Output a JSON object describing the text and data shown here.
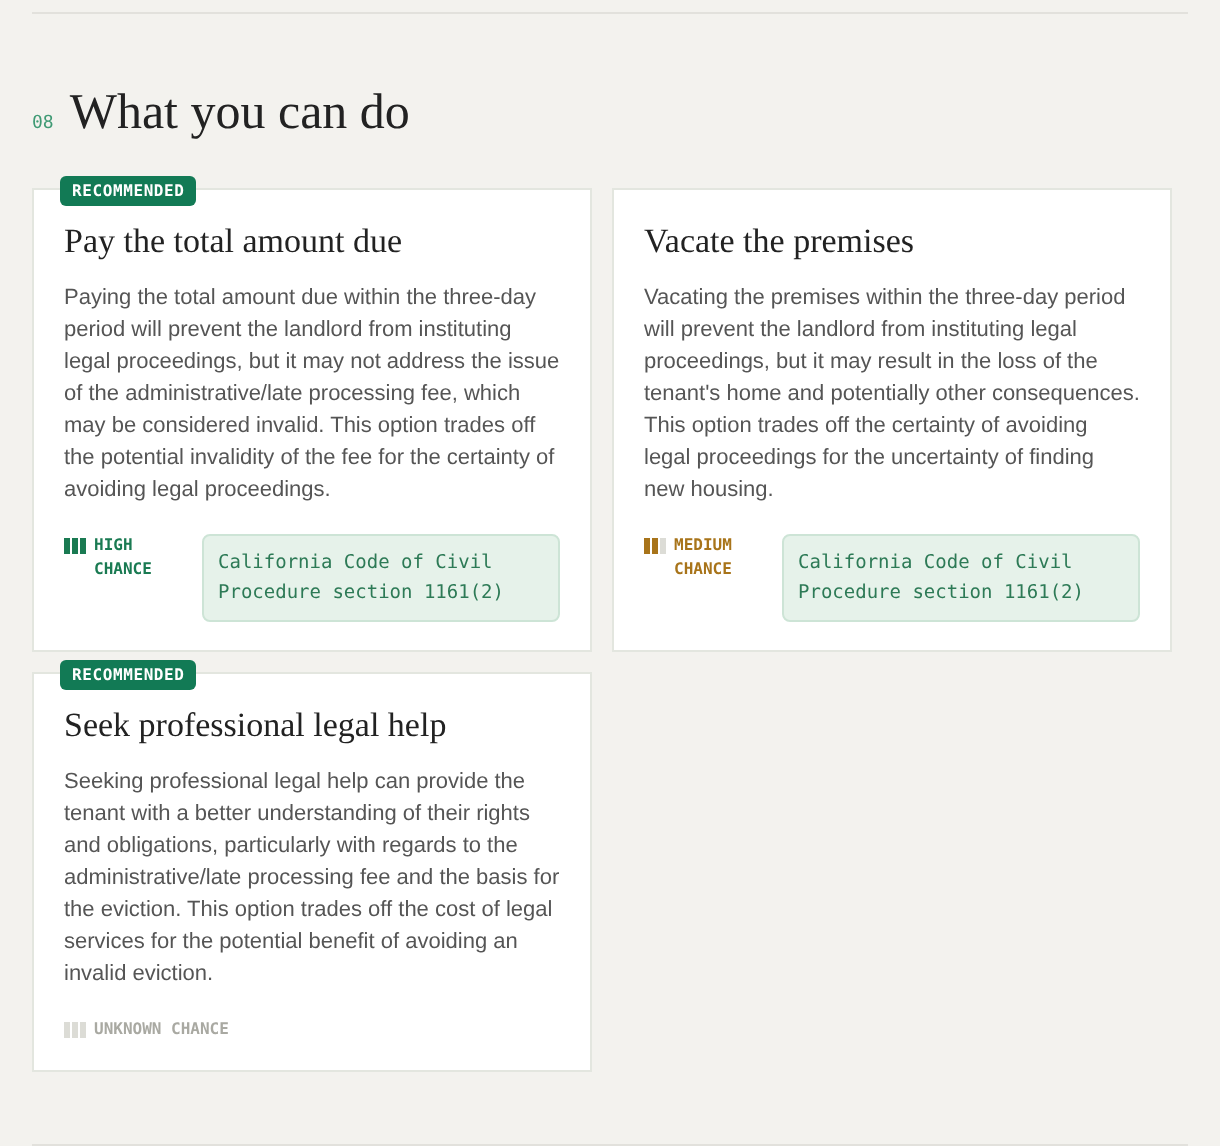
{
  "section": {
    "number": "08",
    "title": "What you can do"
  },
  "options": [
    {
      "badge": "RECOMMENDED",
      "title": "Pay the total amount due",
      "body": "Paying the total amount due within the three-day period will prevent the landlord from instituting legal proceedings, but it may not address the issue of the administrative/late processing fee, which may be considered invalid. This option trades off the potential invalidity of the fee for the certainty of avoiding legal proceedings.",
      "chance": {
        "kind": "high",
        "label": "HIGH CHANCE"
      },
      "citation": "California Code of Civil Procedure section 1161(2)"
    },
    {
      "title": "Vacate the premises",
      "body": "Vacating the premises within the three-day period will prevent the landlord from instituting legal proceedings, but it may result in the loss of the tenant's home and potentially other consequences. This option trades off the certainty of avoiding legal proceedings for the uncertainty of finding new housing.",
      "chance": {
        "kind": "medium",
        "label": "MEDIUM CHANCE"
      },
      "citation": "California Code of Civil Procedure section 1161(2)"
    },
    {
      "badge": "RECOMMENDED",
      "title": "Seek professional legal help",
      "body": "Seeking professional legal help can provide the tenant with a better understanding of their rights and obligations, particularly with regards to the administrative/late processing fee and the basis for the eviction. This option trades off the cost of legal services for the potential benefit of avoiding an invalid eviction.",
      "chance": {
        "kind": "unknown",
        "label": "UNKNOWN CHANCE"
      }
    }
  ]
}
